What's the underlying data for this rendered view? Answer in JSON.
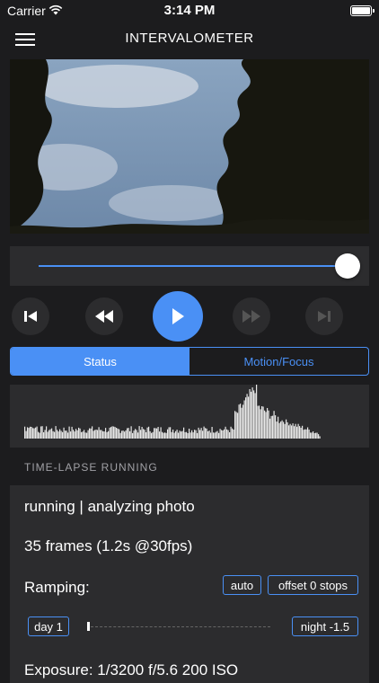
{
  "status_bar": {
    "carrier": "Carrier",
    "time": "3:14 PM"
  },
  "nav": {
    "title": "INTERVALOMETER"
  },
  "tabs": [
    {
      "label": "Status",
      "active": true
    },
    {
      "label": "Motion/Focus",
      "active": false
    }
  ],
  "section": {
    "title": "TIME-LAPSE RUNNING"
  },
  "status": {
    "state": "running | analyzing photo",
    "frames": "35 frames (1.2s @30fps)",
    "ramping_label": "Ramping:",
    "ramping_mode": "auto",
    "ramping_offset": "offset 0 stops",
    "ramp_start": "day 1",
    "ramp_end": "night -1.5",
    "exposure": "Exposure: 1/3200 f/5.6 200 ISO"
  },
  "colors": {
    "accent": "#4a90f5",
    "background": "#1c1c1e",
    "panel": "#2c2c2e"
  },
  "icons": [
    "menu-icon",
    "wifi-icon",
    "battery-icon",
    "skip-back-icon",
    "rewind-icon",
    "play-icon",
    "fast-forward-icon",
    "skip-forward-icon"
  ]
}
